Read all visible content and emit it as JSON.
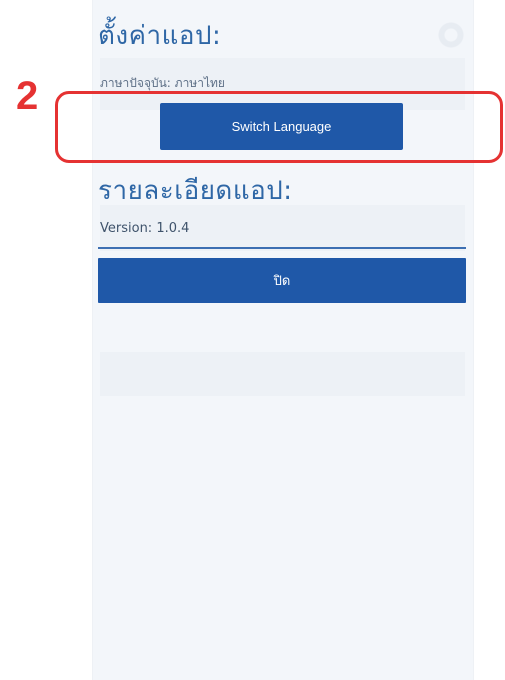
{
  "settings": {
    "title": "ตั้งค่าแอป:",
    "current_language": "ภาษาปัจจุบัน: ภาษาไทย",
    "switch_language_label": "Switch Language"
  },
  "annotation": {
    "step_number": "2",
    "highlight_color": "#e53232"
  },
  "details": {
    "title": "รายละเอียดแอป:",
    "version": "Version: 1.0.4",
    "close_label": "ปิด"
  },
  "colors": {
    "primary": "#1f58a8",
    "heading": "#2f67a6",
    "panel_bg": "#f3f6fa"
  },
  "icons": {
    "settings": "gear-icon"
  }
}
